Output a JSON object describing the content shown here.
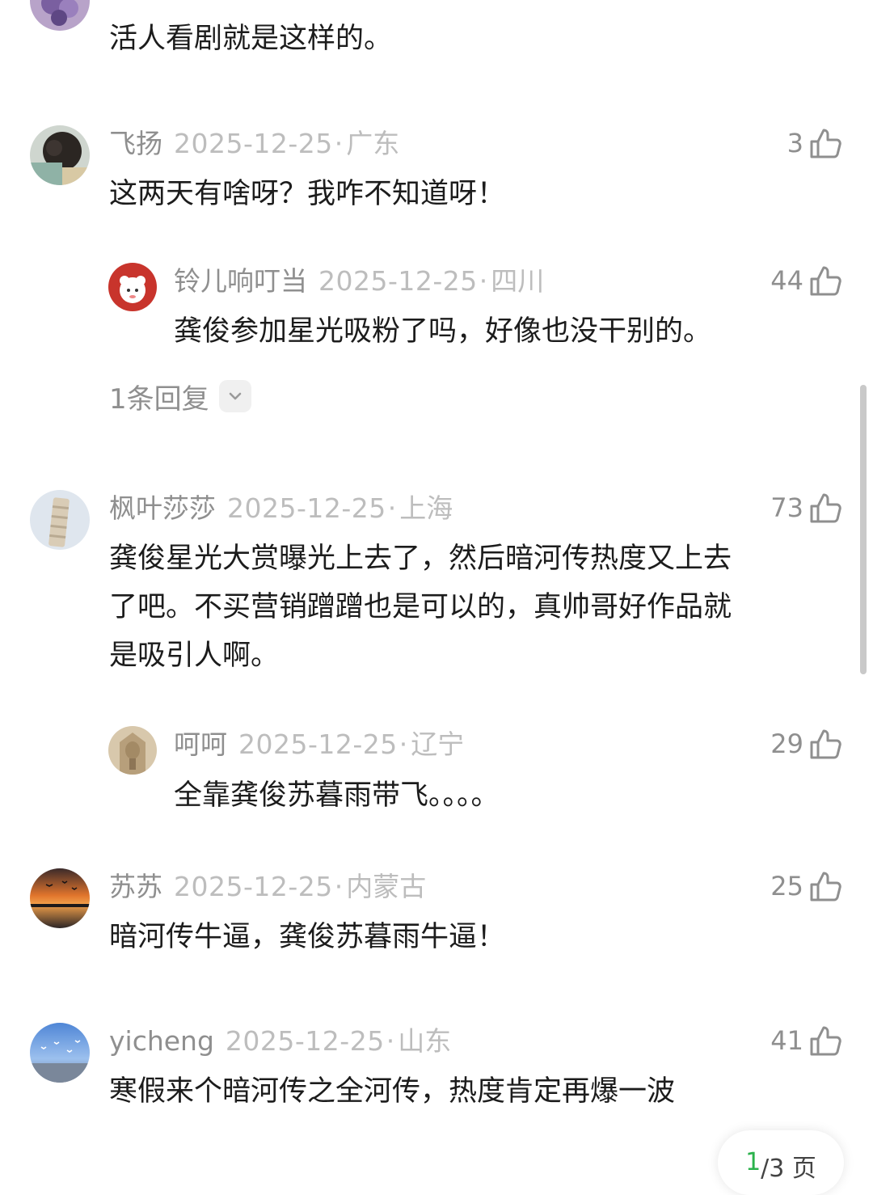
{
  "colors": {
    "name": "#8f8f8f",
    "meta_light": "#bdbdbd",
    "text": "#1c1c1c",
    "pager_current": "#2bb24c",
    "scrollbar": "#c9c9c9"
  },
  "top_partial_comment": {
    "text": "活人看剧就是这样的。",
    "avatar_icon": "user-avatar-icon"
  },
  "comments": [
    {
      "name": "飞扬",
      "date": "2025-12-25",
      "dot": "·",
      "region": "广东",
      "likes": "3",
      "text": "这两天有啥呀？我咋不知道呀！",
      "like_icon": "thumbs-up-icon",
      "reply": {
        "name": "铃儿响叮当",
        "date": "2025-12-25",
        "dot": "·",
        "region": "四川",
        "likes": "44",
        "text": "龚俊参加星光吸粉了吗，好像也没干别的。"
      },
      "replies_toggle": "1条回复"
    },
    {
      "name": "枫叶莎莎",
      "date": "2025-12-25",
      "dot": "·",
      "region": "上海",
      "likes": "73",
      "text_lines": [
        "龚俊星光大赏曝光上去了，然后暗河传热度又上去",
        "了吧。不买营销蹭蹭也是可以的，真帅哥好作品就",
        "是吸引人啊。"
      ],
      "reply": {
        "name": "呵呵",
        "date": "2025-12-25",
        "dot": "·",
        "region": "辽宁",
        "likes": "29",
        "text": "全靠龚俊苏暮雨带飞。。。。"
      }
    },
    {
      "name": "苏苏",
      "date": "2025-12-25",
      "dot": "·",
      "region": "内蒙古",
      "likes": "25",
      "text": "暗河传牛逼，龚俊苏暮雨牛逼！"
    },
    {
      "name": "yicheng",
      "date": "2025-12-25",
      "dot": "·",
      "region": "山东",
      "likes": "41",
      "text": "寒假来个暗河传之全河传，热度肯定再爆一波"
    }
  ],
  "pager": {
    "current": "1",
    "rest": "/3 页"
  }
}
